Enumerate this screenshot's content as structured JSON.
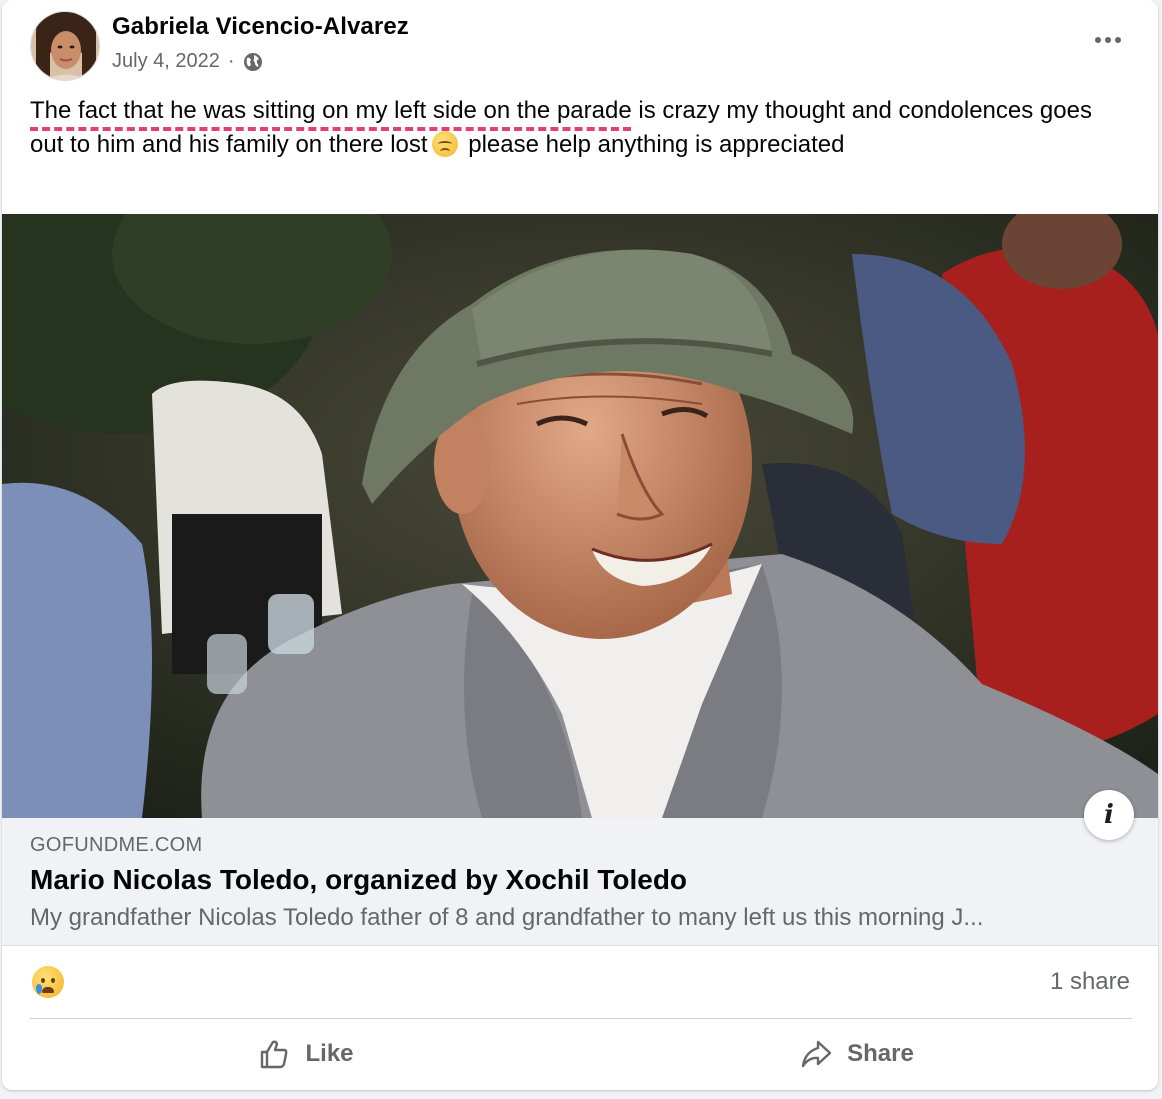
{
  "post": {
    "author": "Gabriela Vicencio-Alvarez",
    "date": "July 4, 2022",
    "separator": "·",
    "privacy_icon": "globe-icon",
    "text_underlined": "The fact that he was sitting on my left side on the parade",
    "text_mid": " is crazy my thought and condolences goes out to him and his family on there lost",
    "text_emoji": "disappointed-face-emoji",
    "text_end": " please help anything is appreciated"
  },
  "link_preview": {
    "domain": "GOFUNDME.COM",
    "title": "Mario Nicolas Toledo, organized by Xochil Toledo",
    "description": "My grandfather Nicolas Toledo father of 8 and grandfather to many left us this morning J..."
  },
  "reactions": {
    "emoji": "crying-face-emoji",
    "share_count": "1 share"
  },
  "actions": {
    "like_label": "Like",
    "share_label": "Share"
  },
  "colors": {
    "underline": "#e0407a",
    "secondary_text": "#65676b",
    "link_bg": "#f0f2f5"
  }
}
